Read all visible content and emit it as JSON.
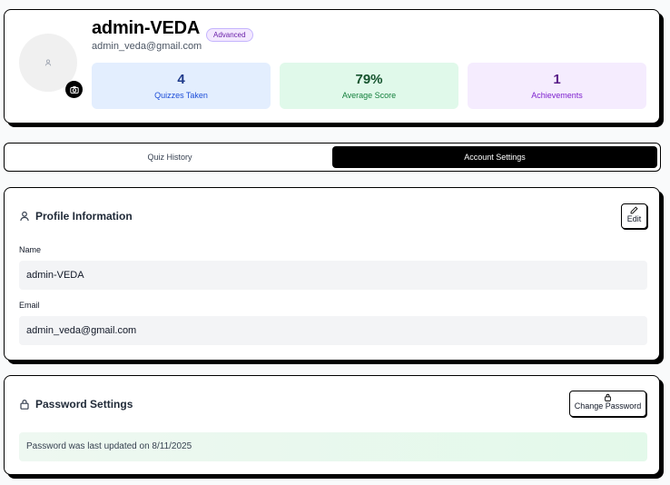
{
  "profile": {
    "name": "admin-VEDA",
    "email": "admin_veda@gmail.com",
    "level_badge": "Advanced",
    "avatar_icon": "user-icon",
    "camera_icon": "camera-icon"
  },
  "stats": [
    {
      "value": "4",
      "label": "Quizzes Taken"
    },
    {
      "value": "79%",
      "label": "Average Score"
    },
    {
      "value": "1",
      "label": "Achievements"
    }
  ],
  "tabs": [
    {
      "label": "Quiz History",
      "active": false
    },
    {
      "label": "Account Settings",
      "active": true
    }
  ],
  "profile_info": {
    "title": "Profile Information",
    "edit_label": "Edit",
    "name_label": "Name",
    "name_value": "admin-VEDA",
    "email_label": "Email",
    "email_value": "admin_veda@gmail.com"
  },
  "password_settings": {
    "title": "Password Settings",
    "change_label": "Change Password",
    "note": "Password was last updated on 8/11/2025"
  },
  "colors": {
    "accent": "#000000",
    "badge_purple": "#6b21a8",
    "stat_blue": "#1d4ed8",
    "stat_green": "#15803d",
    "stat_purple": "#7e22ce"
  }
}
